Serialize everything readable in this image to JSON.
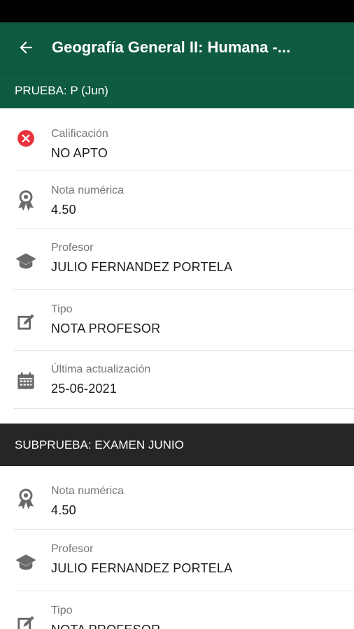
{
  "header": {
    "title": "Geografía General II: Humana -..."
  },
  "prueba": {
    "title": "PRUEBA: P (Jun)",
    "rows": [
      {
        "label": "Calificación",
        "value": "NO APTO",
        "icon": "error-circle-icon"
      },
      {
        "label": "Nota numérica",
        "value": "4.50",
        "icon": "award-ribbon-icon"
      },
      {
        "label": "Profesor",
        "value": "JULIO FERNANDEZ PORTELA",
        "icon": "graduation-cap-icon"
      },
      {
        "label": "Tipo",
        "value": "NOTA PROFESOR",
        "icon": "edit-note-icon"
      },
      {
        "label": "Última actualización",
        "value": "25-06-2021",
        "icon": "calendar-icon"
      }
    ]
  },
  "subprueba": {
    "title": "SUBPRUEBA: EXAMEN JUNIO",
    "rows": [
      {
        "label": "Nota numérica",
        "value": "4.50",
        "icon": "award-ribbon-icon"
      },
      {
        "label": "Profesor",
        "value": "JULIO FERNANDEZ PORTELA",
        "icon": "graduation-cap-icon"
      },
      {
        "label": "Tipo",
        "value": "NOTA PROFESOR",
        "icon": "edit-note-icon"
      }
    ]
  },
  "colors": {
    "primary": "#0f5a43",
    "dark_header": "#262626",
    "error": "#e8323c",
    "icon_gray": "#6b6b6b"
  }
}
